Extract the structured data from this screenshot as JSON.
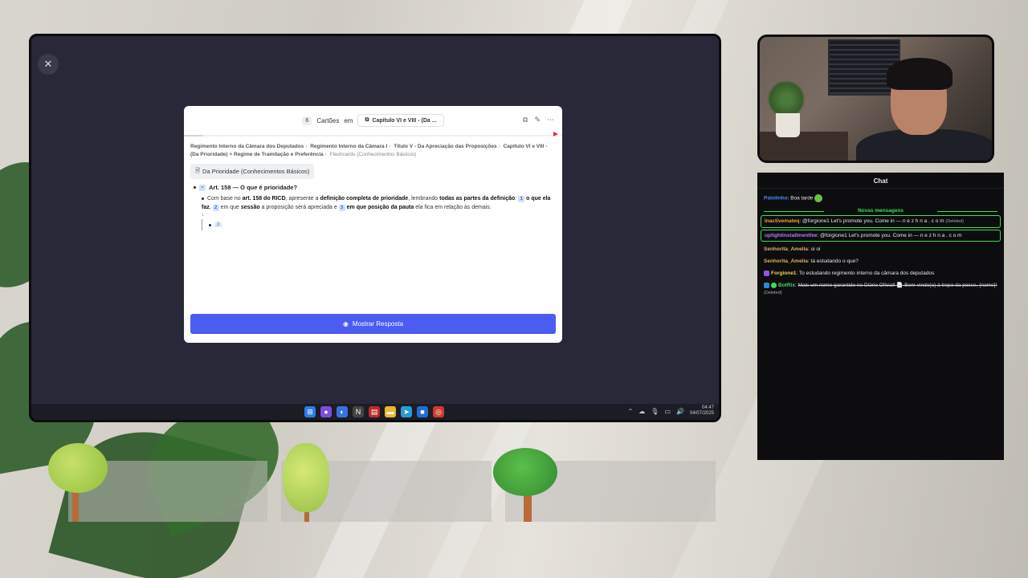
{
  "screen": {
    "close_icon": "close-icon",
    "flashcard": {
      "count": "6",
      "cards_label": "Cartões",
      "in_label": "em",
      "deck_name": "Capítulo VI e VIII - (Da ...",
      "breadcrumb": {
        "part1": "Regimento Interno da Câmara dos Deputados",
        "part2": "Regimento Interno da Câmara I",
        "part3": "Título V - Da Apreciação das Proposições",
        "part4": "Capítulo VI e VIII -",
        "part5": "(Da Prioridade) + Regime de Tramitação e Preferência",
        "part6": "Flashcards (Conhecimentos Básicos)"
      },
      "topic": "Da Prioridade (Conhecimentos Básicos)",
      "question_title": "Art. 158 — O que é prioridade?",
      "body": {
        "t1": "Com base no ",
        "b1": "art. 158 do RICD",
        "t2": ", apresente a ",
        "b2": "definição completa de prioridade",
        "t3": ", lembrando ",
        "b3": "todas as partes da definição",
        "t4": ": ",
        "n1": "1",
        "b4": "o que ela faz",
        "t5": ", ",
        "n2": "2",
        "t6": " em que ",
        "b5": "sessão",
        "t7": " a proposição será apreciada e ",
        "n3": "3",
        "b6": " em que posição da pauta",
        "t8": " ela fica em relação às demais."
      },
      "arrow": "↓",
      "answer_number": "3",
      "show_answer_label": "Mostrar Resposta",
      "progress": 0.05
    },
    "taskbar": {
      "time": "04:47",
      "date": "04/07/2025"
    }
  },
  "chat": {
    "title": "Chat",
    "new_messages_label": "Novas mensagens",
    "messages": [
      {
        "user": "Patolinho",
        "text": "Boa tarde"
      },
      {
        "user": "inactivemateq",
        "text": "@forgione1 Let's promote you. Come  in — n e z h n a  . c o m",
        "deleted": "(Deleted)"
      },
      {
        "user": "uptightinstallmenthw",
        "text": "@forgione1 Let's promote you. Come  in — n e z h n a  . c o m"
      },
      {
        "user": "Senhorita_Amelia",
        "text": "oi oi"
      },
      {
        "user": "Senhorita_Amelia",
        "text": "tá estudando o que?"
      },
      {
        "user": "Forgione1",
        "text": "To estudando regimento interno da câmara dos deputados"
      },
      {
        "user": "BotRix",
        "text": "Mais um nome garantido no Diário Oficial! 📄 Bem-vindo(a) à tropa da posse, {name}!",
        "deleted": "(Deleted)"
      }
    ]
  }
}
